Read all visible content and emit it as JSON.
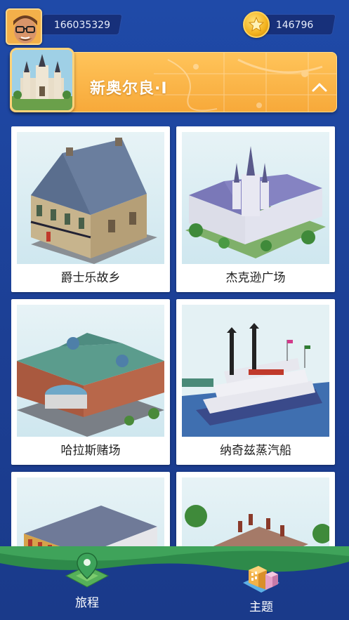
{
  "header": {
    "user_id": "166035329",
    "coins": "146796"
  },
  "banner": {
    "city_title": "新奥尔良·I",
    "expanded": true
  },
  "attractions": [
    {
      "name": "爵士乐故乡"
    },
    {
      "name": "杰克逊广场"
    },
    {
      "name": "哈拉斯赌场"
    },
    {
      "name": "纳奇兹蒸汽船"
    },
    {
      "name": ""
    },
    {
      "name": ""
    }
  ],
  "nav": {
    "trip_label": "旅程",
    "theme_label": "主题"
  },
  "colors": {
    "background": "#1f4aa8",
    "banner": "#f7a93a",
    "coin": "#f3b21d"
  }
}
